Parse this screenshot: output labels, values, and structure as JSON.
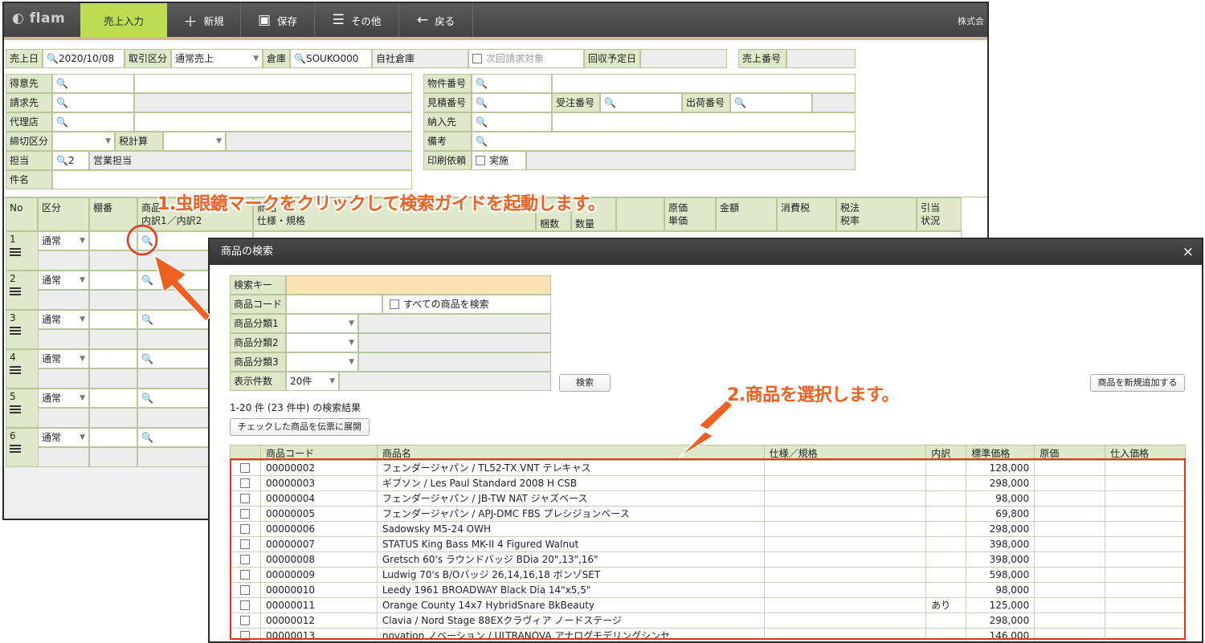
{
  "toolbar": {
    "logo": "flam",
    "active_tab": "売上入力",
    "new": "新規",
    "save": "保存",
    "other": "その他",
    "back": "戻る",
    "company": "株式会"
  },
  "header_row": {
    "date_label": "売上日",
    "date_value": "2020/10/08",
    "tx_label": "取引区分",
    "tx_value": "通常売上",
    "warehouse_label": "倉庫",
    "warehouse_code": "SOUKO000",
    "warehouse_name": "自社倉庫",
    "next_bill": "次回請求対象",
    "collect_label": "回収予定日",
    "sales_no_label": "売上番号"
  },
  "left_form": {
    "customer": "得意先",
    "billing": "請求先",
    "agent": "代理店",
    "closing": "締切区分",
    "tax_calc": "税計算",
    "staff": "担当",
    "staff_code": "2",
    "staff_name": "営業担当",
    "subject": "件名"
  },
  "right_form": {
    "property_no": "物件番号",
    "estimate_no": "見積番号",
    "order_no": "受注番号",
    "ship_no": "出荷番号",
    "delivery": "納入先",
    "note": "備考",
    "print_req": "印刷依頼",
    "print_exec": "実施"
  },
  "grid": {
    "headers": {
      "no": "No",
      "kubun": "区分",
      "tana": "棚番",
      "item_a": "商品",
      "item_b": "内訳1／内訳2",
      "item_c": "商品",
      "spec": "仕様・規格",
      "cases": "梱数",
      "qty": "数量",
      "cost_a": "原価",
      "cost_b": "単価",
      "amount": "金額",
      "tax": "消費税",
      "taxlaw_a": "税法",
      "taxlaw_b": "税率",
      "alloc_a": "引当",
      "alloc_b": "状況"
    },
    "rows": [
      {
        "no": "1",
        "kubun": "通常"
      },
      {
        "no": "2",
        "kubun": "通常"
      },
      {
        "no": "3",
        "kubun": "通常"
      },
      {
        "no": "4",
        "kubun": "通常"
      },
      {
        "no": "5",
        "kubun": "通常"
      },
      {
        "no": "6",
        "kubun": "通常"
      }
    ]
  },
  "dialog": {
    "title": "商品の検索",
    "close": "×",
    "search_key": "検索キー",
    "code": "商品コード",
    "all_items": "すべての商品を検索",
    "cat1": "商品分類1",
    "cat2": "商品分類2",
    "cat3": "商品分類3",
    "count_label": "表示件数",
    "count_value": "20件",
    "search_btn": "検索",
    "add_btn": "商品を新規追加する",
    "result_summary": "1-20 件 (23 件中) の検索結果",
    "expand_btn": "チェックした商品を伝票に展開",
    "columns": [
      "",
      "商品コード",
      "商品名",
      "仕様／規格",
      "内訳",
      "標準価格",
      "原価",
      "仕入価格"
    ],
    "results": [
      {
        "code": "00000002",
        "name": "フェンダージャパン / TL52-TX VNT テレキャス",
        "breakdown": "",
        "price": "128,000"
      },
      {
        "code": "00000003",
        "name": "ギブソン / Les Paul Standard 2008 H CSB",
        "breakdown": "",
        "price": "298,000"
      },
      {
        "code": "00000004",
        "name": "フェンダージャパン / JB-TW NAT ジャズベース",
        "breakdown": "",
        "price": "98,000"
      },
      {
        "code": "00000005",
        "name": "フェンダージャパン / APJ-DMC FBS プレシジョンベース",
        "breakdown": "",
        "price": "69,800"
      },
      {
        "code": "00000006",
        "name": "Sadowsky M5-24 OWH",
        "breakdown": "",
        "price": "298,000"
      },
      {
        "code": "00000007",
        "name": "STATUS King Bass MK-II 4 Figured Walnut",
        "breakdown": "",
        "price": "398,000"
      },
      {
        "code": "00000008",
        "name": "Gretsch 60's ラウンドバッジ BDia 20\",13\",16\"",
        "breakdown": "",
        "price": "398,000"
      },
      {
        "code": "00000009",
        "name": "Ludwig 70's B/Oバッジ 26,14,16,18 ボンゾSET",
        "breakdown": "",
        "price": "598,000"
      },
      {
        "code": "00000010",
        "name": "Leedy 1961 BROADWAY Black Dia 14\"x5,5\"",
        "breakdown": "",
        "price": "98,000"
      },
      {
        "code": "00000011",
        "name": "Orange County 14x7 HybridSnare BkBeauty",
        "breakdown": "あり",
        "price": "125,000"
      },
      {
        "code": "00000012",
        "name": "Clavia / Nord Stage 88EXクラヴィア ノードステージ",
        "breakdown": "",
        "price": "298,000"
      },
      {
        "code": "00000013",
        "name": "novation ノベーション / ULTRANOVA アナログモデリングシンセ",
        "breakdown": "",
        "price": "146,000"
      }
    ]
  },
  "annotations": {
    "step1": "1.虫眼鏡マークをクリックして検索ガイドを起動します。",
    "step2": "2.商品を選択します。"
  },
  "colors": {
    "accent": "#bfdd52",
    "label_bg": "#dfe8c8",
    "annotation": "#f06020",
    "highlight": "#e8321a"
  }
}
